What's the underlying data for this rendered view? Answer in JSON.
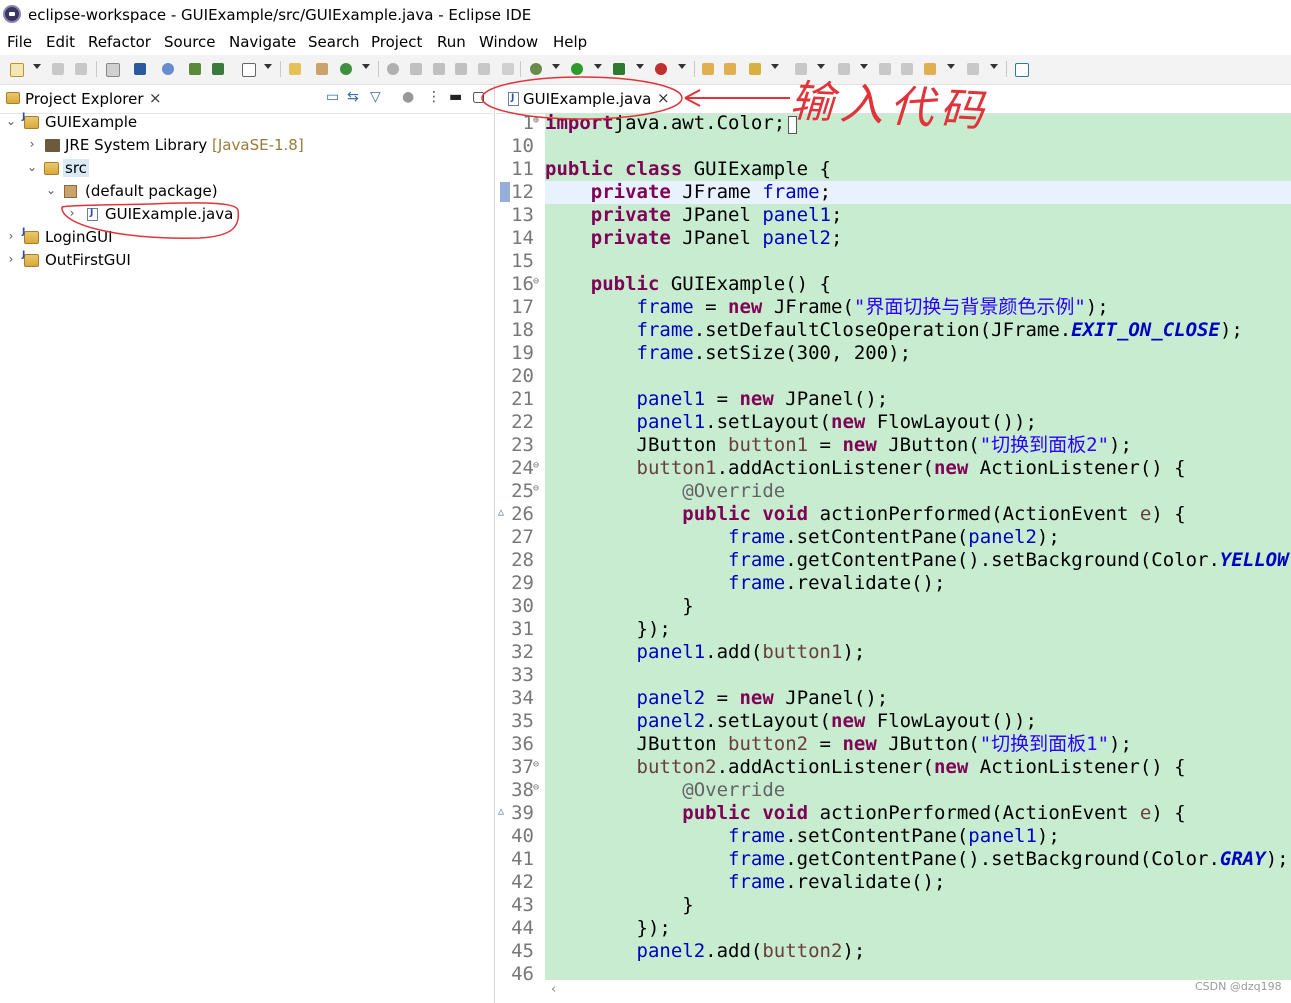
{
  "window": {
    "title": "eclipse-workspace - GUIExample/src/GUIExample.java - Eclipse IDE"
  },
  "menu": [
    "File",
    "Edit",
    "Refactor",
    "Source",
    "Navigate",
    "Search",
    "Project",
    "Run",
    "Window",
    "Help"
  ],
  "project_explorer": {
    "tab_label": "Project Explorer",
    "tree": {
      "project1": "GUIExample",
      "jre_label": "JRE System Library",
      "jre_decoration": "[JavaSE-1.8]",
      "src": "src",
      "package": "(default package)",
      "file": "GUIExample.java",
      "project2": "LoginGUI",
      "project3": "OutFirstGUI"
    }
  },
  "editor": {
    "tab_label": "GUIExample.java",
    "lines": [
      {
        "n": "1",
        "fold": "+",
        "tokens": [
          [
            "kw",
            "import"
          ],
          [
            "",
            "java.awt.Color;"
          ]
        ]
      },
      {
        "n": "10",
        "tokens": []
      },
      {
        "n": "11",
        "tokens": [
          [
            "kw",
            "public class"
          ],
          [
            "",
            " GUIExample {"
          ]
        ]
      },
      {
        "n": "12",
        "tokens": [
          [
            "",
            "    "
          ],
          [
            "kw",
            "private"
          ],
          [
            "",
            " JFrame "
          ],
          [
            "fld",
            "frame"
          ],
          [
            "",
            ";"
          ]
        ]
      },
      {
        "n": "13",
        "tokens": [
          [
            "",
            "    "
          ],
          [
            "kw",
            "private"
          ],
          [
            "",
            " JPanel "
          ],
          [
            "fld",
            "panel1"
          ],
          [
            "",
            ";"
          ]
        ]
      },
      {
        "n": "14",
        "tokens": [
          [
            "",
            "    "
          ],
          [
            "kw",
            "private"
          ],
          [
            "",
            " JPanel "
          ],
          [
            "fld",
            "panel2"
          ],
          [
            "",
            ";"
          ]
        ]
      },
      {
        "n": "15",
        "tokens": []
      },
      {
        "n": "16",
        "fold": "−",
        "tokens": [
          [
            "",
            "    "
          ],
          [
            "kw",
            "public"
          ],
          [
            "",
            " GUIExample() {"
          ]
        ]
      },
      {
        "n": "17",
        "tokens": [
          [
            "",
            "        "
          ],
          [
            "fld",
            "frame"
          ],
          [
            "",
            " = "
          ],
          [
            "kw",
            "new"
          ],
          [
            "",
            " JFrame("
          ],
          [
            "str",
            "\"界面切换与背景颜色示例\""
          ],
          [
            "",
            ");"
          ]
        ]
      },
      {
        "n": "18",
        "tokens": [
          [
            "",
            "        "
          ],
          [
            "fld",
            "frame"
          ],
          [
            "",
            ".setDefaultCloseOperation(JFrame."
          ],
          [
            "st",
            "EXIT_ON_CLOSE"
          ],
          [
            "",
            ");"
          ]
        ]
      },
      {
        "n": "19",
        "tokens": [
          [
            "",
            "        "
          ],
          [
            "fld",
            "frame"
          ],
          [
            "",
            ".setSize(300, 200);"
          ]
        ]
      },
      {
        "n": "20",
        "tokens": []
      },
      {
        "n": "21",
        "tokens": [
          [
            "",
            "        "
          ],
          [
            "fld",
            "panel1"
          ],
          [
            "",
            " = "
          ],
          [
            "kw",
            "new"
          ],
          [
            "",
            " JPanel();"
          ]
        ]
      },
      {
        "n": "22",
        "tokens": [
          [
            "",
            "        "
          ],
          [
            "fld",
            "panel1"
          ],
          [
            "",
            ".setLayout("
          ],
          [
            "kw",
            "new"
          ],
          [
            "",
            " FlowLayout());"
          ]
        ]
      },
      {
        "n": "23",
        "tokens": [
          [
            "",
            "        JButton "
          ],
          [
            "lv",
            "button1"
          ],
          [
            "",
            " = "
          ],
          [
            "kw",
            "new"
          ],
          [
            "",
            " JButton("
          ],
          [
            "str",
            "\"切换到面板2\""
          ],
          [
            "",
            ");"
          ]
        ]
      },
      {
        "n": "24",
        "fold": "−",
        "tokens": [
          [
            "",
            "        "
          ],
          [
            "lv",
            "button1"
          ],
          [
            "",
            ".addActionListener("
          ],
          [
            "kw",
            "new"
          ],
          [
            "",
            " ActionListener() {"
          ]
        ]
      },
      {
        "n": "25",
        "fold": "−",
        "tokens": [
          [
            "",
            "            "
          ],
          [
            "ann",
            "@Override"
          ]
        ]
      },
      {
        "n": "26",
        "ov": "△",
        "tokens": [
          [
            "",
            "            "
          ],
          [
            "kw",
            "public void"
          ],
          [
            "",
            " actionPerformed(ActionEvent "
          ],
          [
            "lv",
            "e"
          ],
          [
            "",
            ") {"
          ]
        ]
      },
      {
        "n": "27",
        "tokens": [
          [
            "",
            "                "
          ],
          [
            "fld",
            "frame"
          ],
          [
            "",
            ".setContentPane("
          ],
          [
            "fld",
            "panel2"
          ],
          [
            "",
            ");"
          ]
        ]
      },
      {
        "n": "28",
        "tokens": [
          [
            "",
            "                "
          ],
          [
            "fld",
            "frame"
          ],
          [
            "",
            ".getContentPane().setBackground(Color."
          ],
          [
            "st",
            "YELLOW"
          ],
          [
            "",
            ");"
          ]
        ]
      },
      {
        "n": "29",
        "tokens": [
          [
            "",
            "                "
          ],
          [
            "fld",
            "frame"
          ],
          [
            "",
            ".revalidate();"
          ]
        ]
      },
      {
        "n": "30",
        "tokens": [
          [
            "",
            "            }"
          ]
        ]
      },
      {
        "n": "31",
        "tokens": [
          [
            "",
            "        });"
          ]
        ]
      },
      {
        "n": "32",
        "tokens": [
          [
            "",
            "        "
          ],
          [
            "fld",
            "panel1"
          ],
          [
            "",
            ".add("
          ],
          [
            "lv",
            "button1"
          ],
          [
            "",
            ");"
          ]
        ]
      },
      {
        "n": "33",
        "tokens": []
      },
      {
        "n": "34",
        "tokens": [
          [
            "",
            "        "
          ],
          [
            "fld",
            "panel2"
          ],
          [
            "",
            " = "
          ],
          [
            "kw",
            "new"
          ],
          [
            "",
            " JPanel();"
          ]
        ]
      },
      {
        "n": "35",
        "tokens": [
          [
            "",
            "        "
          ],
          [
            "fld",
            "panel2"
          ],
          [
            "",
            ".setLayout("
          ],
          [
            "kw",
            "new"
          ],
          [
            "",
            " FlowLayout());"
          ]
        ]
      },
      {
        "n": "36",
        "tokens": [
          [
            "",
            "        JButton "
          ],
          [
            "lv",
            "button2"
          ],
          [
            "",
            " = "
          ],
          [
            "kw",
            "new"
          ],
          [
            "",
            " JButton("
          ],
          [
            "str",
            "\"切换到面板1\""
          ],
          [
            "",
            ");"
          ]
        ]
      },
      {
        "n": "37",
        "fold": "−",
        "tokens": [
          [
            "",
            "        "
          ],
          [
            "lv",
            "button2"
          ],
          [
            "",
            ".addActionListener("
          ],
          [
            "kw",
            "new"
          ],
          [
            "",
            " ActionListener() {"
          ]
        ]
      },
      {
        "n": "38",
        "fold": "−",
        "tokens": [
          [
            "",
            "            "
          ],
          [
            "ann",
            "@Override"
          ]
        ]
      },
      {
        "n": "39",
        "ov": "△",
        "tokens": [
          [
            "",
            "            "
          ],
          [
            "kw",
            "public void"
          ],
          [
            "",
            " actionPerformed(ActionEvent "
          ],
          [
            "lv",
            "e"
          ],
          [
            "",
            ") {"
          ]
        ]
      },
      {
        "n": "40",
        "tokens": [
          [
            "",
            "                "
          ],
          [
            "fld",
            "frame"
          ],
          [
            "",
            ".setContentPane("
          ],
          [
            "fld",
            "panel1"
          ],
          [
            "",
            ");"
          ]
        ]
      },
      {
        "n": "41",
        "tokens": [
          [
            "",
            "                "
          ],
          [
            "fld",
            "frame"
          ],
          [
            "",
            ".getContentPane().setBackground(Color."
          ],
          [
            "st",
            "GRAY"
          ],
          [
            "",
            ");"
          ]
        ]
      },
      {
        "n": "42",
        "tokens": [
          [
            "",
            "                "
          ],
          [
            "fld",
            "frame"
          ],
          [
            "",
            ".revalidate();"
          ]
        ]
      },
      {
        "n": "43",
        "tokens": [
          [
            "",
            "            }"
          ]
        ]
      },
      {
        "n": "44",
        "tokens": [
          [
            "",
            "        });"
          ]
        ]
      },
      {
        "n": "45",
        "tokens": [
          [
            "",
            "        "
          ],
          [
            "fld",
            "panel2"
          ],
          [
            "",
            ".add("
          ],
          [
            "lv",
            "button2"
          ],
          [
            "",
            ");"
          ]
        ]
      },
      {
        "n": "46",
        "tokens": []
      }
    ]
  },
  "annotation": {
    "handwritten_note": "输入代码"
  },
  "watermark": "CSDN @dzq198",
  "colors": {
    "code_bg": "#c7ecd0",
    "current_line": "#e8f2fe",
    "keyword": "#7f0055",
    "field": "#0000c0",
    "string": "#2a00ff",
    "annotation_red": "#e0343a"
  }
}
